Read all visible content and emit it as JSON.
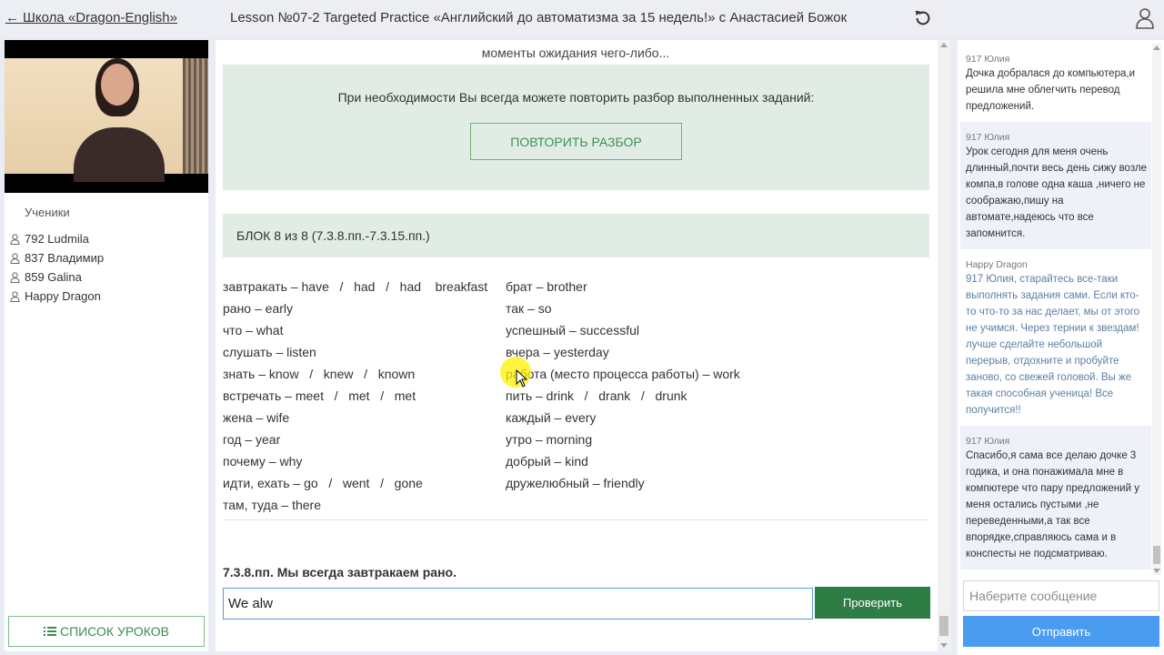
{
  "header": {
    "back_link": "← Школа «Dragon-English»",
    "lesson_title": "Lesson №07-2 Targeted Practice «Английский до автоматизма за 15 недель!» с Анастасией Божок"
  },
  "sidebar": {
    "students_label": "Ученики",
    "students": [
      "792 Ludmila",
      "837 Владимир",
      "859 Galina",
      "Happy Dragon"
    ],
    "lessons_button": "СПИСОК УРОКОВ"
  },
  "main": {
    "top_text": "моменты ожидания чего-либо...",
    "repeat_text": "При необходимости Вы всегда можете повторить разбор выполненных заданий:",
    "repeat_button": "ПОВТОРИТЬ РАЗБОР",
    "block_title": "БЛОК 8 из 8 (7.3.8.пп.-7.3.15.пп.)",
    "vocab_left": [
      "завтракать – have   /   had   /   had    breakfast",
      "рано – early",
      "что – what",
      "слушать – listen",
      "знать – know   /   knew   /   known",
      "встречать – meet   /   met   /   met",
      "жена – wife",
      "год – year",
      "почему – why",
      "идти, ехать – go   /   went   /   gone",
      "там, туда – there"
    ],
    "vocab_right": [
      "брат – brother",
      "так – so",
      "успешный – successful",
      "вчера – yesterday",
      "работа (место процесса работы) – work",
      "пить – drink   /   drank   /   drunk",
      "каждый – every",
      "утро – morning",
      "добрый – kind",
      "дружелюбный – friendly"
    ],
    "task_label": "7.3.8.пп. Мы всегда завтракаем рано.",
    "answer_value": "We alw",
    "check_button": "Проверить"
  },
  "chat": {
    "messages": [
      {
        "author": "917 Юлия",
        "text": "Дочка добралася до компьютера,и решила мне облегчить перевод предложений.",
        "teacher": false
      },
      {
        "author": "917 Юлия",
        "text": "Урок сегодня для меня очень длинный,почти весь день сижу возле компа,в голове одна каша ,ничего не соображаю,пишу на автомате,надеюсь что все запомнится.",
        "teacher": false
      },
      {
        "author": "Happy Dragon",
        "text": "917 Юлия, старайтесь все-таки выполнять задания сами. Если кто-то что-то за нас делает, мы от этого не учимся. Через тернии к звездам! лучше сделайте небольшой перерыв, отдохните и пробуйте заново, со свежей головой. Вы же такая способная ученица! Все получится!!",
        "teacher": true
      },
      {
        "author": "917 Юлия",
        "text": "Спасибо,я сама все делаю дочке 3 годика, и она понажимала мне в компютере что пару предложений у меня остались пустыми ,не переведенными,а так все впорядке,справляюсь сама и в конспесты не подсматриваю.",
        "teacher": false
      }
    ],
    "input_placeholder": "Наберите сообщение",
    "send_button": "Отправить"
  },
  "colors": {
    "accent_green": "#2e7d45",
    "panel_green": "#e1ede4",
    "send_blue": "#4a9cf0",
    "teacher_text": "#5a7fa6"
  }
}
